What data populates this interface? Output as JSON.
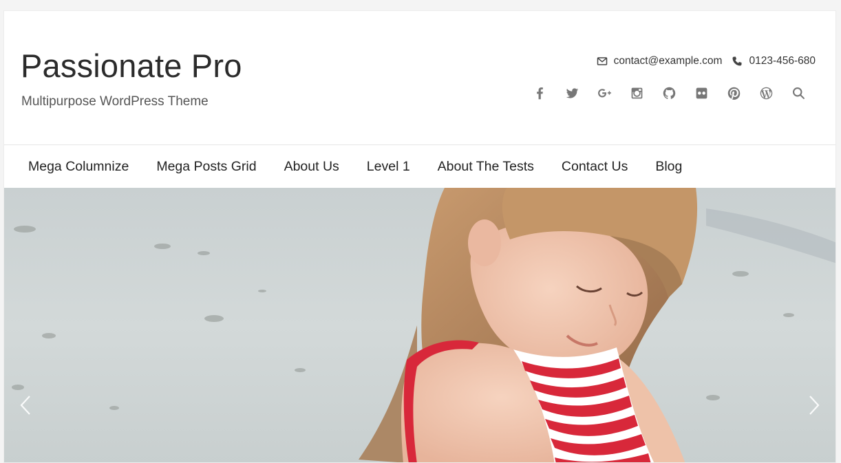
{
  "site": {
    "title": "Passionate Pro",
    "tagline": "Multipurpose WordPress Theme"
  },
  "contact": {
    "email": "contact@example.com",
    "phone": "0123-456-680",
    "email_icon": "envelope-icon",
    "phone_icon": "phone-icon"
  },
  "social": [
    {
      "name": "facebook-icon"
    },
    {
      "name": "twitter-icon"
    },
    {
      "name": "google-plus-icon"
    },
    {
      "name": "instagram-icon"
    },
    {
      "name": "github-icon"
    },
    {
      "name": "flickr-icon"
    },
    {
      "name": "pinterest-icon"
    },
    {
      "name": "wordpress-icon"
    },
    {
      "name": "search-icon"
    }
  ],
  "nav": {
    "items": [
      {
        "label": "Mega Columnize"
      },
      {
        "label": "Mega Posts Grid"
      },
      {
        "label": "About Us"
      },
      {
        "label": "Level 1"
      },
      {
        "label": "About The Tests"
      },
      {
        "label": "Contact Us"
      },
      {
        "label": "Blog"
      }
    ]
  },
  "slider": {
    "prev_icon": "chevron-left-icon",
    "next_icon": "chevron-right-icon"
  },
  "colors": {
    "background": "#f4f4f4",
    "text": "#2b2b2b",
    "icon": "#777777"
  }
}
